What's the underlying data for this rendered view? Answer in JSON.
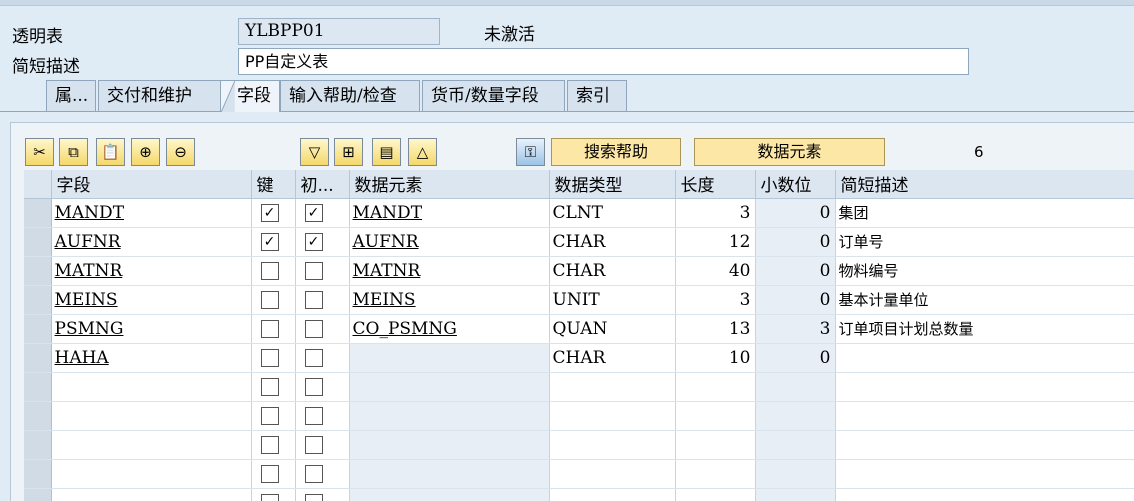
{
  "header": {
    "table_label": "透明表",
    "table_name": "YLBPP01",
    "status": "未激活",
    "desc_label": "简短描述",
    "desc_value": "PP自定义表"
  },
  "tabs": [
    {
      "label": "属..."
    },
    {
      "label": "交付和维护"
    },
    {
      "label": "字段",
      "active": true
    },
    {
      "label": "输入帮助/检查"
    },
    {
      "label": "货币/数量字段"
    },
    {
      "label": "索引"
    }
  ],
  "toolbar": {
    "icons": [
      "cut-icon",
      "copy-icon",
      "paste-icon",
      "insert-row-icon",
      "delete-row-icon",
      "expand-icon",
      "copy-field-icon",
      "field-list-icon",
      "collapse-icon",
      "key-icon"
    ],
    "search_help_label": "搜索帮助",
    "data_element_label": "数据元素",
    "field_count": "6"
  },
  "columns": [
    "字段",
    "键",
    "初...",
    "数据元素",
    "数据类型",
    "长度",
    "小数位",
    "简短描述"
  ],
  "rows": [
    {
      "field": "MANDT",
      "key": true,
      "init": true,
      "element": "MANDT",
      "type": "CLNT",
      "length": "3",
      "decimals": "0",
      "desc": "集团"
    },
    {
      "field": "AUFNR",
      "key": true,
      "init": true,
      "element": "AUFNR",
      "type": "CHAR",
      "length": "12",
      "decimals": "0",
      "desc": "订单号"
    },
    {
      "field": "MATNR",
      "key": false,
      "init": false,
      "element": "MATNR",
      "type": "CHAR",
      "length": "40",
      "decimals": "0",
      "desc": "物料编号"
    },
    {
      "field": "MEINS",
      "key": false,
      "init": false,
      "element": "MEINS",
      "type": "UNIT",
      "length": "3",
      "decimals": "0",
      "desc": "基本计量单位"
    },
    {
      "field": "PSMNG",
      "key": false,
      "init": false,
      "element": "CO_PSMNG",
      "type": "QUAN",
      "length": "13",
      "decimals": "3",
      "desc": "订单项目计划总数量"
    },
    {
      "field": "HAHA",
      "key": false,
      "init": false,
      "element": "",
      "type": "CHAR",
      "length": "10",
      "decimals": "0",
      "desc": ""
    }
  ],
  "empty_rows": 5,
  "colors": {
    "background": "#dfebf5",
    "button_yellow": "#fde7a7",
    "header_blue": "#dbe6f1"
  }
}
